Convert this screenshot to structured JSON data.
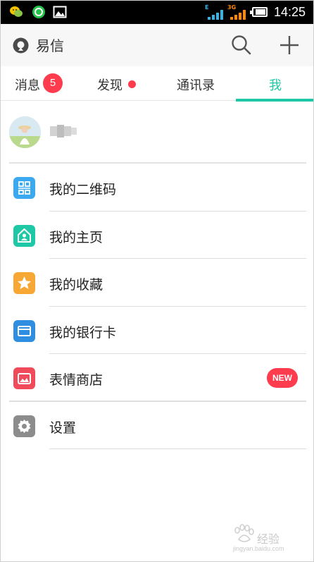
{
  "status_bar": {
    "time": "14:25",
    "signal1_tag": "E",
    "signal2_tag": "3G",
    "notification_icons": [
      "wechat-icon",
      "message-icon",
      "gallery-icon"
    ],
    "battery_level": 0.85
  },
  "header": {
    "app_name": "易信",
    "search_icon": "search-icon",
    "add_icon": "plus-icon"
  },
  "tabs": [
    {
      "label": "消息",
      "badge": "5"
    },
    {
      "label": "发现",
      "dot": true
    },
    {
      "label": "通讯录"
    },
    {
      "label": "我",
      "active": true
    }
  ],
  "profile": {
    "name": ""
  },
  "menu": [
    {
      "label": "我的二维码",
      "icon": "qrcode-icon",
      "color": "#3ba9f0"
    },
    {
      "label": "我的主页",
      "icon": "home-icon",
      "color": "#1ec8a6"
    },
    {
      "label": "我的收藏",
      "icon": "star-icon",
      "color": "#f7a733"
    },
    {
      "label": "我的银行卡",
      "icon": "card-icon",
      "color": "#2f8ee0"
    },
    {
      "label": "表情商店",
      "icon": "sticker-icon",
      "color": "#f04b5a",
      "badge": "NEW"
    },
    {
      "label": "设置",
      "icon": "gear-icon",
      "color": "#8c8c8c"
    }
  ],
  "colors": {
    "accent": "#1ec8a6",
    "badge": "#ff3b4e"
  },
  "watermark": {
    "text": "经验",
    "url": "jingyan.baidu.com"
  }
}
